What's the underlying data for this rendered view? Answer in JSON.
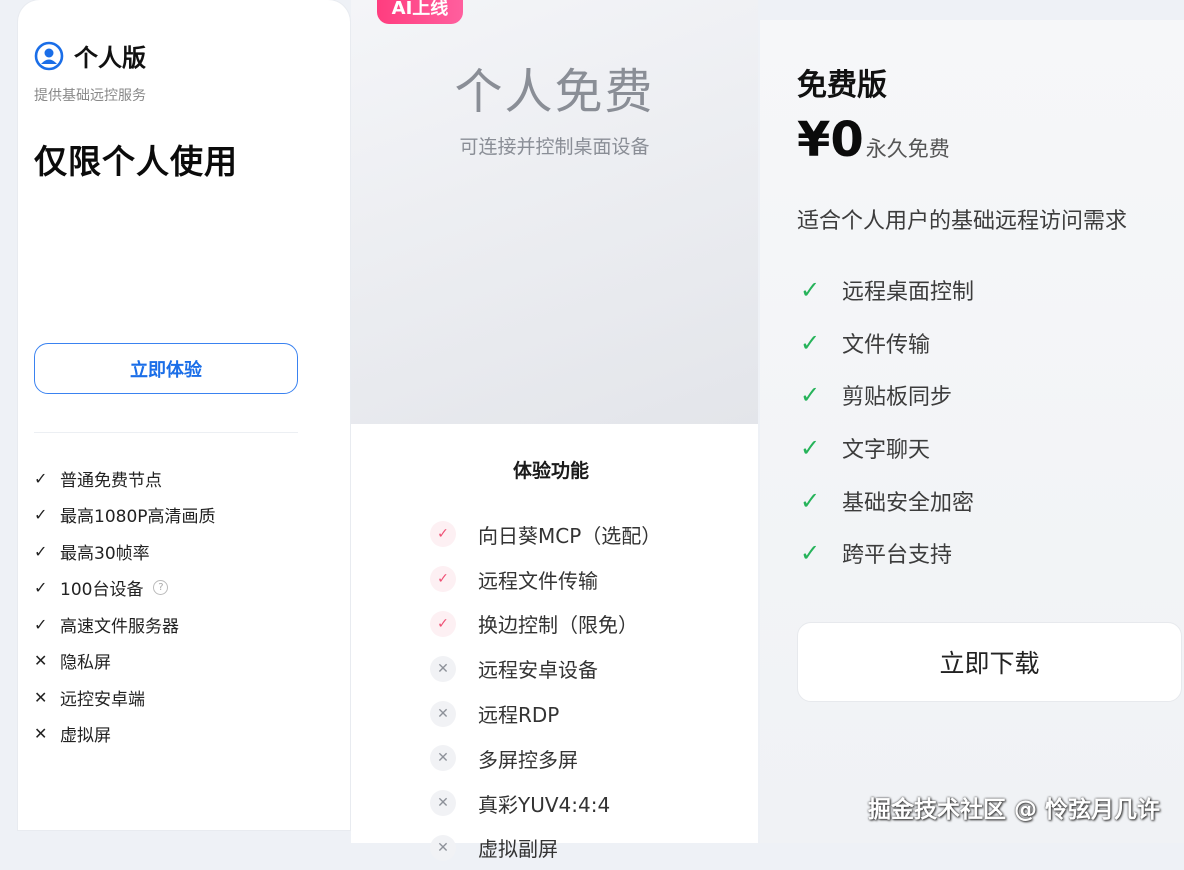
{
  "left_card": {
    "plan_name": "个人版",
    "plan_sub": "提供基础远控服务",
    "plan_big": "仅限个人使用",
    "try_button": "立即体验",
    "features": [
      {
        "mark": "✓",
        "label": "普通免费节点"
      },
      {
        "mark": "✓",
        "label": "最高1080P高清画质"
      },
      {
        "mark": "✓",
        "label": "最高30帧率"
      },
      {
        "mark": "✓",
        "label": "100台设备",
        "help": "?"
      },
      {
        "mark": "✓",
        "label": "高速文件服务器"
      },
      {
        "mark": "✕",
        "label": "隐私屏"
      },
      {
        "mark": "✕",
        "label": "远控安卓端"
      },
      {
        "mark": "✕",
        "label": "虚拟屏"
      }
    ]
  },
  "middle": {
    "badge": "AI上线",
    "title": "个人免费",
    "subtitle": "可连接并控制桌面设备",
    "exp_title": "体验功能",
    "exp_items": [
      {
        "mark": "✓",
        "label": "向日葵MCP（选配）"
      },
      {
        "mark": "✓",
        "label": "远程文件传输"
      },
      {
        "mark": "✓",
        "label": "换边控制（限免）"
      },
      {
        "mark": "✕",
        "label": "远程安卓设备"
      },
      {
        "mark": "✕",
        "label": "远程RDP"
      },
      {
        "mark": "✕",
        "label": "多屏控多屏"
      },
      {
        "mark": "✕",
        "label": "真彩YUV4:4:4"
      },
      {
        "mark": "✕",
        "label": "虚拟副屏"
      }
    ]
  },
  "right_card": {
    "title": "免费版",
    "price": "¥0",
    "price_note": "永久免费",
    "desc": "适合个人用户的基础远程访问需求",
    "features": [
      "远程桌面控制",
      "文件传输",
      "剪贴板同步",
      "文字聊天",
      "基础安全加密",
      "跨平台支持"
    ],
    "check_mark": "✓",
    "download_button": "立即下载"
  },
  "watermark": "掘金技术社区 @ 怜弦月几许",
  "colors": {
    "accent_blue": "#1a6ee8",
    "badge_pink": "#ff3d7f",
    "check_green": "#26b35a"
  }
}
